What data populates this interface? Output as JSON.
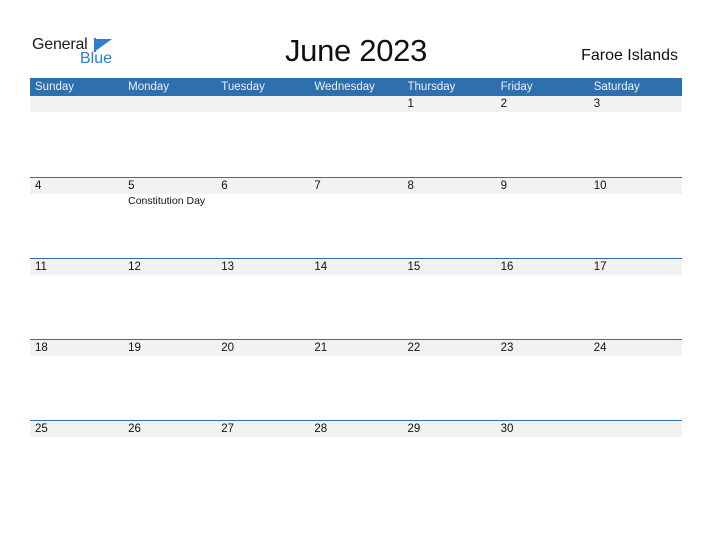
{
  "logo": {
    "word1": "General",
    "word2": "Blue",
    "icon": "triangle-flag-icon"
  },
  "title": "June 2023",
  "country": "Faroe Islands",
  "colors": {
    "header_bg": "#2e6fb0",
    "strip_bg": "#f2f2f2",
    "logo_blue": "#2a7fd0"
  },
  "weekdays": [
    "Sunday",
    "Monday",
    "Tuesday",
    "Wednesday",
    "Thursday",
    "Friday",
    "Saturday"
  ],
  "weeks": [
    {
      "days": [
        "",
        "",
        "",
        "",
        "1",
        "2",
        "3"
      ],
      "events": [
        "",
        "",
        "",
        "",
        "",
        "",
        ""
      ]
    },
    {
      "days": [
        "4",
        "5",
        "6",
        "7",
        "8",
        "9",
        "10"
      ],
      "events": [
        "",
        "Constitution Day",
        "",
        "",
        "",
        "",
        ""
      ]
    },
    {
      "days": [
        "11",
        "12",
        "13",
        "14",
        "15",
        "16",
        "17"
      ],
      "events": [
        "",
        "",
        "",
        "",
        "",
        "",
        ""
      ]
    },
    {
      "days": [
        "18",
        "19",
        "20",
        "21",
        "22",
        "23",
        "24"
      ],
      "events": [
        "",
        "",
        "",
        "",
        "",
        "",
        ""
      ]
    },
    {
      "days": [
        "25",
        "26",
        "27",
        "28",
        "29",
        "30",
        ""
      ],
      "events": [
        "",
        "",
        "",
        "",
        "",
        "",
        ""
      ]
    }
  ]
}
